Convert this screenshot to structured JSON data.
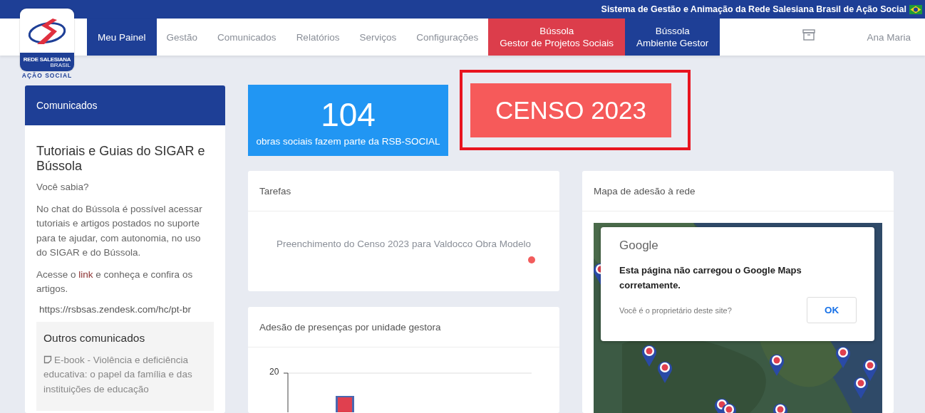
{
  "top_bar": {
    "title": "Sistema de Gestão e Animação da Rede Salesiana Brasil de Ação Social"
  },
  "logo": {
    "line_1": "REDE SALESIANA",
    "line_2": "BRASIL",
    "caption": "AÇÃO SOCIAL"
  },
  "nav": [
    {
      "kind": "link",
      "label": "Meu Painel",
      "selected": true
    },
    {
      "kind": "link",
      "label": "Gestão",
      "selected": false
    },
    {
      "kind": "link",
      "label": "Comunicados",
      "selected": false
    },
    {
      "kind": "link",
      "label": "Relatórios",
      "selected": false
    },
    {
      "kind": "link",
      "label": "Serviços",
      "selected": false
    },
    {
      "kind": "link",
      "label": "Configurações",
      "selected": false
    },
    {
      "kind": "feature",
      "label": "Bússola",
      "sublabel": "Gestor de Projetos Sociais",
      "color": "#dc3d4b"
    },
    {
      "kind": "feature",
      "label": "Bússola",
      "sublabel": "Ambiente Gestor",
      "color": "#1e3f96"
    }
  ],
  "user": {
    "name": "Ana Maria"
  },
  "announcements": {
    "header": "Comunicados",
    "title": "Tutoriais e Guias do SIGAR e Bússola",
    "question": "Você sabia?",
    "text": "No chat do Bússola é possível acessar tutoriais e artigos postados no suporte para te ajudar, com autonomia, no uso do SIGAR e do Bússola.",
    "cta": [
      "Acesse o ",
      "link",
      " e conheça e confira os artigos."
    ],
    "url": "https://rsbsas.zendesk.com/hc/pt-br",
    "others": {
      "title": "Outros comunicados",
      "items": [
        "E-book - Violência e deficiência educativa: o papel da família e das instituições de educação"
      ]
    }
  },
  "stat": {
    "value": "104",
    "caption": "obras sociais fazem parte da RSB-SOCIAL"
  },
  "census_button": {
    "label": "CENSO 2023"
  },
  "tasks": {
    "title": "Tarefas",
    "items": [
      {
        "text": "Preenchimento do Censo 2023 para Valdocco Obra Modelo",
        "color": "#f25c5c"
      }
    ]
  },
  "attendance": {
    "title": "Adesão de presenças por unidade gestora",
    "tick_label": "20"
  },
  "map": {
    "title": "Mapa de adesão à rede",
    "dialog": {
      "brand": "Google",
      "message": "Esta página não carregou o Google Maps corretamente.",
      "question": "Você é o proprietário deste site?",
      "button": "OK"
    }
  }
}
